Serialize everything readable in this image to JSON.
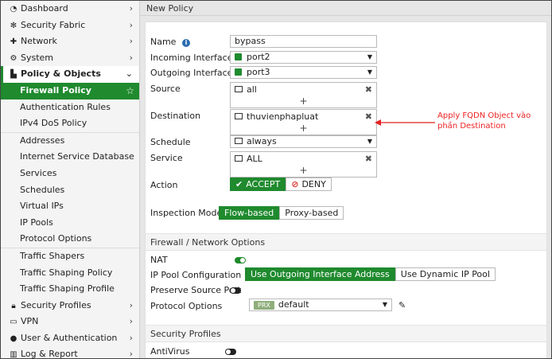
{
  "sidebar": {
    "items_top": [
      {
        "icon": "dashboard-icon",
        "label": "Dashboard"
      },
      {
        "icon": "security-fabric-icon",
        "label": "Security Fabric"
      },
      {
        "icon": "network-icon",
        "label": "Network"
      },
      {
        "icon": "gear-icon",
        "label": "System"
      }
    ],
    "policy_objects": {
      "icon": "policy-icon",
      "label": "Policy & Objects"
    },
    "sub_items": [
      {
        "label": "Firewall Policy"
      },
      {
        "label": "Authentication Rules"
      },
      {
        "label": "IPv4 DoS Policy"
      },
      {
        "label": "Addresses"
      },
      {
        "label": "Internet Service Database"
      },
      {
        "label": "Services"
      },
      {
        "label": "Schedules"
      },
      {
        "label": "Virtual IPs"
      },
      {
        "label": "IP Pools"
      },
      {
        "label": "Protocol Options"
      },
      {
        "label": "Traffic Shapers"
      },
      {
        "label": "Traffic Shaping Policy"
      },
      {
        "label": "Traffic Shaping Profile"
      }
    ],
    "items_bottom": [
      {
        "icon": "lock-icon",
        "label": "Security Profiles"
      },
      {
        "icon": "vpn-icon",
        "label": "VPN"
      },
      {
        "icon": "user-icon",
        "label": "User & Authentication"
      },
      {
        "icon": "chart-icon",
        "label": "Log & Report"
      }
    ]
  },
  "page": {
    "title": "New Policy"
  },
  "form": {
    "name_label": "Name",
    "name_value": "bypass",
    "incoming_label": "Incoming Interface",
    "incoming_value": "port2",
    "outgoing_label": "Outgoing Interface",
    "outgoing_value": "port3",
    "source_label": "Source",
    "source_value": "all",
    "destination_label": "Destination",
    "destination_value": "thuvienphapluat",
    "schedule_label": "Schedule",
    "schedule_value": "always",
    "service_label": "Service",
    "service_value": "ALL",
    "action_label": "Action",
    "action_accept": "ACCEPT",
    "action_deny": "DENY",
    "inspection_label": "Inspection Mode",
    "inspection_flow": "Flow-based",
    "inspection_proxy": "Proxy-based",
    "plus": "+",
    "remove": "✖"
  },
  "firewall_options": {
    "heading": "Firewall / Network Options",
    "nat_label": "NAT",
    "ippool_label": "IP Pool Configuration",
    "ippool_outgoing": "Use Outgoing Interface Address",
    "ippool_dynamic": "Use Dynamic IP Pool",
    "preserve_label": "Preserve Source Port",
    "protocol_label": "Protocol Options",
    "protocol_badge": "PRX",
    "protocol_value": "default"
  },
  "security_profiles": {
    "heading": "Security Profiles",
    "antivirus_label": "AntiVirus"
  },
  "annotation": {
    "line1": "Apply FQDN Object vào",
    "line2": "phần Destination",
    "color": "#e22222"
  },
  "colors": {
    "accent": "#1f8a2e"
  }
}
